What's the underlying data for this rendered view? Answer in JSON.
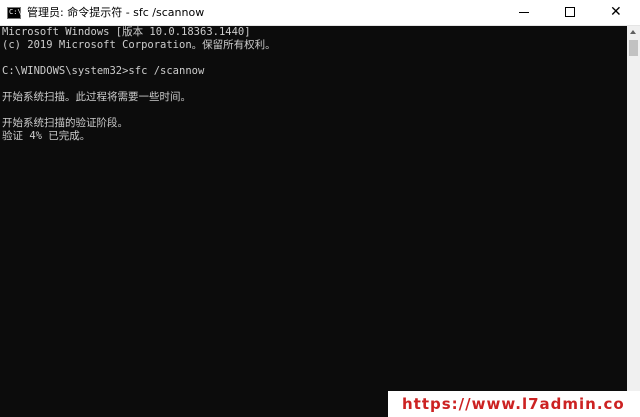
{
  "window": {
    "title": "管理员: 命令提示符 - sfc  /scannow",
    "icon": "cmd-icon",
    "icon_prompt": "C:\\",
    "controls": {
      "minimize_icon": "minimize-icon",
      "maximize_icon": "maximize-icon",
      "close_icon": "close-icon",
      "close_glyph": "✕"
    }
  },
  "console": {
    "lines": [
      "Microsoft Windows [版本 10.0.18363.1440]",
      "(c) 2019 Microsoft Corporation。保留所有权利。",
      "",
      "C:\\WINDOWS\\system32>sfc /scannow",
      "",
      "开始系统扫描。此过程将需要一些时间。",
      "",
      "开始系统扫描的验证阶段。",
      "验证 4% 已完成。"
    ],
    "text_color": "#cccccc",
    "background_color": "#0c0c0c"
  },
  "watermark": {
    "text": "https://www.l7admin.co"
  }
}
